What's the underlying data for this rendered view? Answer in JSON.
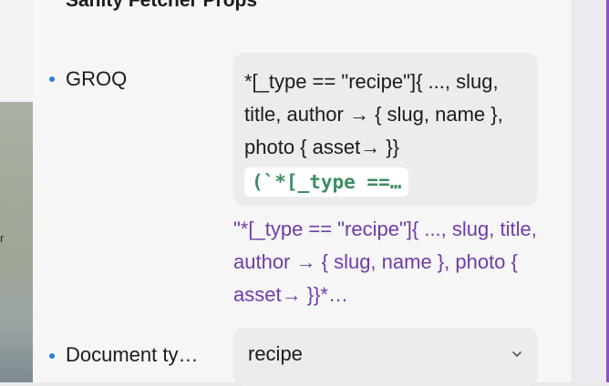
{
  "panel": {
    "title": "Sanity Fetcher Props"
  },
  "background": {
    "photo_text": "r"
  },
  "props": [
    {
      "label": "GROQ",
      "query_text": "*[_type == \"recipe\"]{  ..., slug,  title,  author → { slug, name },  photo { asset→ }}",
      "code_chip": "(`*[_type ==…",
      "value_text": "\"*[_type == \"recipe\"]{ ..., slug, title, author → { slug, name }, photo { asset→ }}*…"
    },
    {
      "label": "Document ty…",
      "selected": "recipe",
      "icon": "chevron-down-icon"
    }
  ],
  "colors": {
    "bullet": "#2f7de1",
    "code": "#3e8e62",
    "value": "#6f3ca8",
    "edge_accent": "#8b4fc4"
  }
}
